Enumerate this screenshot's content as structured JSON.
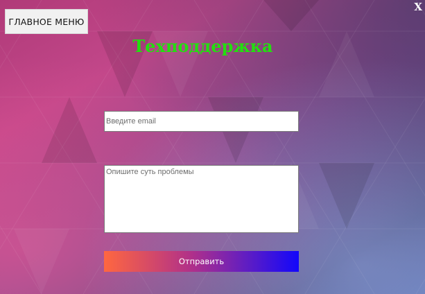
{
  "header": {
    "menu_button_label": "ГЛАВНОЕ МЕНЮ",
    "close_label": "X"
  },
  "main": {
    "title": "Техподдержка",
    "email_placeholder": "Введите email",
    "email_value": "",
    "problem_placeholder": "Опишите суть проблемы",
    "problem_value": "",
    "submit_label": "Отправить"
  },
  "colors": {
    "title": "#22e00f",
    "submit_gradient_start": "#ff6740",
    "submit_gradient_end": "#1207fb",
    "close": "#ffffff"
  },
  "icons": {
    "close": "x-close-icon",
    "background": "triangle-pattern"
  }
}
